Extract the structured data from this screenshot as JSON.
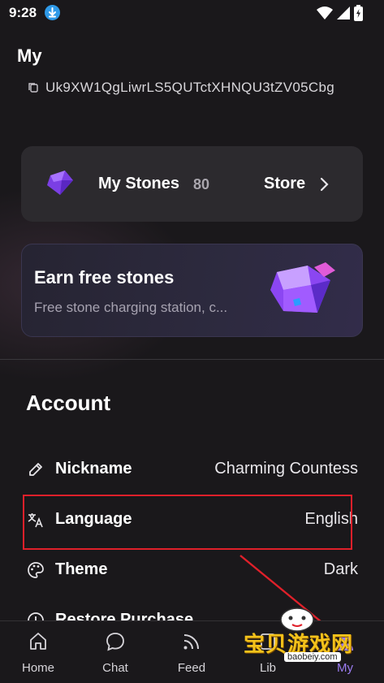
{
  "status_bar": {
    "time": "9:28"
  },
  "header": {
    "title": "My"
  },
  "profile": {
    "uid": "Uk9XW1QgLiwrLS5QUTctXHNQU3tZV05Cbg"
  },
  "stones": {
    "label": "My Stones",
    "count": "80",
    "store_label": "Store"
  },
  "earn": {
    "title": "Earn free stones",
    "subtitle": "Free stone charging station, c..."
  },
  "account": {
    "title": "Account",
    "rows": [
      {
        "label": "Nickname",
        "value": "Charming Countess",
        "icon": "pencil-icon"
      },
      {
        "label": "Language",
        "value": "English",
        "icon": "translate-icon"
      },
      {
        "label": "Theme",
        "value": "Dark",
        "icon": "palette-icon"
      },
      {
        "label": "Restore Purchase",
        "value": "",
        "icon": "info-icon"
      }
    ]
  },
  "nav": {
    "items": [
      {
        "label": "Home",
        "icon": "home-icon"
      },
      {
        "label": "Chat",
        "icon": "chat-icon"
      },
      {
        "label": "Feed",
        "icon": "rss-icon"
      },
      {
        "label": "Lib",
        "icon": "library-icon"
      },
      {
        "label": "My",
        "icon": "person-icon"
      }
    ],
    "active": "My"
  },
  "watermark": {
    "text": "宝贝游戏网",
    "url": "baobeiy.com"
  },
  "colors": {
    "accent": "#9b7cf0",
    "highlight": "#e0202a",
    "background": "#1a181b",
    "card": "#2c2a2e"
  }
}
